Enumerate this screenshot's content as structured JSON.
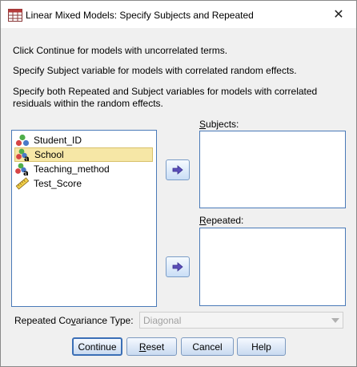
{
  "window": {
    "title": "Linear Mixed Models: Specify Subjects and Repeated"
  },
  "instructions": {
    "line1": "Click Continue for models with uncorrelated terms.",
    "line2": "Specify Subject variable for models with correlated random effects.",
    "line3a": "Specify both Repeated and Subject variables for models with correlated",
    "line3b": "residuals within the random effects."
  },
  "variables": [
    {
      "label": "Student_ID",
      "icon": "nominal-variable-icon"
    },
    {
      "label": "School",
      "icon": "nominal-string-variable-icon",
      "selected": true
    },
    {
      "label": "Teaching_method",
      "icon": "nominal-string-variable-icon"
    },
    {
      "label": "Test_Score",
      "icon": "scale-variable-icon"
    }
  ],
  "subjects": {
    "label_mnemonic": "S",
    "label_rest": "ubjects:"
  },
  "repeated": {
    "label_mnemonic": "R",
    "label_rest": "epeated:"
  },
  "covariance": {
    "label_pre": "Repeated Co",
    "label_mnemonic": "v",
    "label_post": "ariance Type:",
    "value": "Diagonal"
  },
  "buttons": {
    "continue": "Continue",
    "reset_mnemonic": "R",
    "reset_rest": "eset",
    "cancel": "Cancel",
    "help": "Help"
  }
}
